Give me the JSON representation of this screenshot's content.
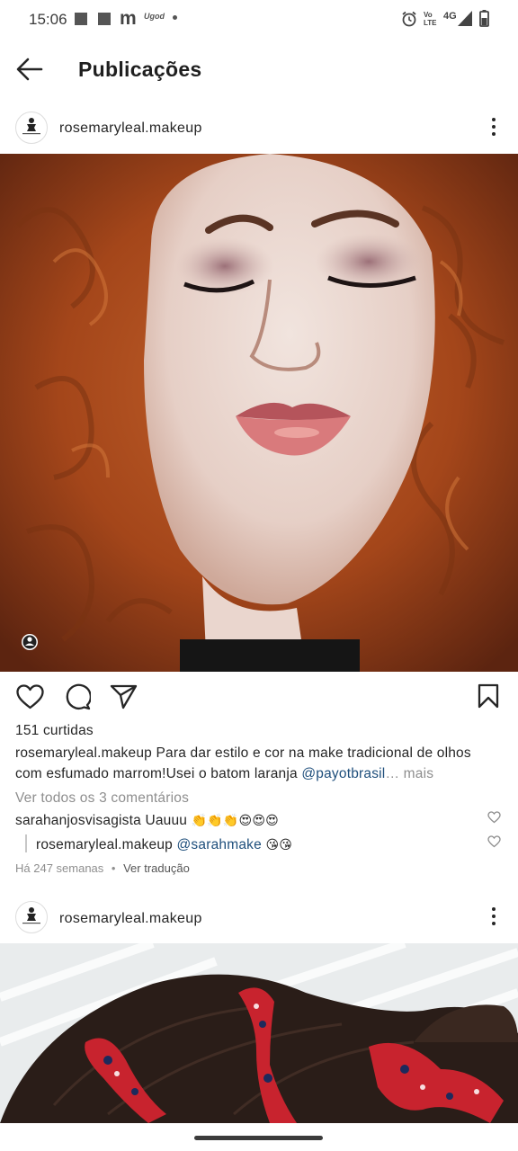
{
  "status_bar": {
    "time": "15:06",
    "tiny_label": "Ugod",
    "volte_top": "Vo",
    "volte_bottom": "LTE",
    "network": "4G",
    "icons": [
      "gallery-icon",
      "gallery-icon",
      "m-app-icon",
      "notification-dot-icon",
      "alarm-icon",
      "signal-icon",
      "battery-icon"
    ]
  },
  "header": {
    "title": "Publicações"
  },
  "posts": [
    {
      "username": "rosemaryleal.makeup",
      "likes": "151 curtidas",
      "caption_user": "rosemaryleal.makeup",
      "caption_line1": "Para dar estilo e cor na make tradicional de olhos",
      "caption_line2": "com  esfumado marrom!Usei o batom laranja",
      "caption_mention": "@payotbrasil",
      "caption_ellipsis": "…",
      "more": "mais",
      "view_comments": "Ver todos os 3 comentários",
      "comments": [
        {
          "user": "sarahanjosvisagista",
          "text": "Uauuu",
          "emoji": "👏👏👏😍😍😍"
        },
        {
          "user": "rosemaryleal.makeup",
          "mention": "@sarahmake",
          "emoji": "😘😘"
        }
      ],
      "time_ago": "Há 247 semanas",
      "separator": "•",
      "translate": "Ver tradução"
    },
    {
      "username": "rosemaryleal.makeup"
    }
  ],
  "colors": {
    "text": "#262626",
    "secondary": "#8e8e8e",
    "mention": "#1f4f7c",
    "hair": "#a9471a"
  }
}
